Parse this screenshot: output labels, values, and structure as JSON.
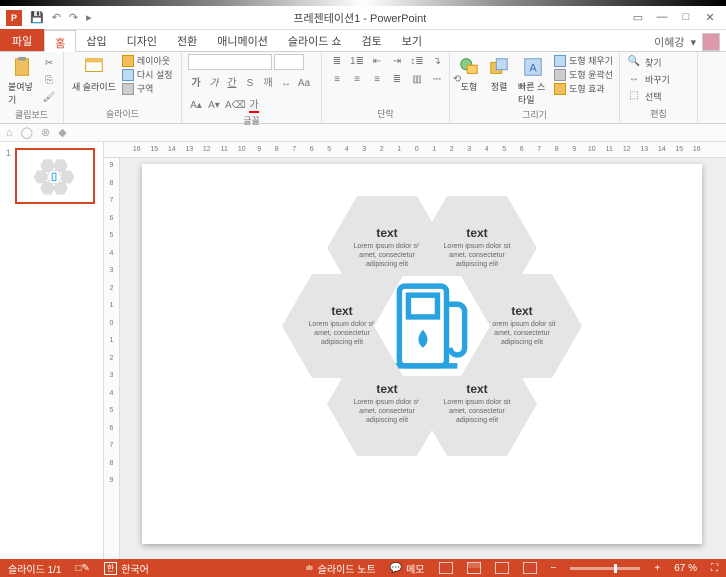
{
  "title": "프레젠테이션1 - PowerPoint",
  "app_icon_letter": "P",
  "user_name": "이혜강",
  "tabs": {
    "file": "파일",
    "home": "홈",
    "insert": "삽입",
    "design": "디자인",
    "transitions": "전환",
    "animations": "애니메이션",
    "slideshow": "슬라이드 쇼",
    "review": "검토",
    "view": "보기"
  },
  "ribbon": {
    "clipboard": {
      "label": "클립보드",
      "paste": "붙여넣기"
    },
    "slides": {
      "label": "슬라이드",
      "new_slide": "새 슬라이드",
      "layout": "레이아웃",
      "reset": "다시 설정",
      "section": "구역"
    },
    "font": {
      "label": "글꼴"
    },
    "paragraph": {
      "label": "단락"
    },
    "drawing": {
      "label": "그리기",
      "shapes": "도형",
      "arrange": "정렬",
      "quick_styles": "빠른 스타일",
      "shape_fill": "도형 채우기",
      "shape_outline": "도형 윤곽선",
      "shape_effects": "도형 효과"
    },
    "editing": {
      "label": "편집",
      "find": "찾기",
      "replace": "바꾸기",
      "select": "선택"
    }
  },
  "ruler_h": [
    "16",
    "15",
    "14",
    "13",
    "12",
    "11",
    "10",
    "9",
    "8",
    "7",
    "6",
    "5",
    "4",
    "3",
    "2",
    "1",
    "0",
    "1",
    "2",
    "3",
    "4",
    "5",
    "6",
    "7",
    "8",
    "9",
    "10",
    "11",
    "12",
    "13",
    "14",
    "15",
    "16"
  ],
  "ruler_v": [
    "9",
    "8",
    "7",
    "6",
    "5",
    "4",
    "3",
    "2",
    "1",
    "0",
    "1",
    "2",
    "3",
    "4",
    "5",
    "6",
    "7",
    "8",
    "9"
  ],
  "slide_thumb_number": "1",
  "hex": {
    "title": "text",
    "body": "Lorem ipsum dolor sit amet, consectetur adipiscing elit"
  },
  "statusbar": {
    "slide_count": "슬라이드 1/1",
    "lang_icon": "한",
    "language": "한국어",
    "notes": "슬라이드 노트",
    "comments": "메모",
    "zoom_minus": "−",
    "zoom_plus": "+",
    "zoom_value": "67 %",
    "fit_icon": "⛶"
  }
}
